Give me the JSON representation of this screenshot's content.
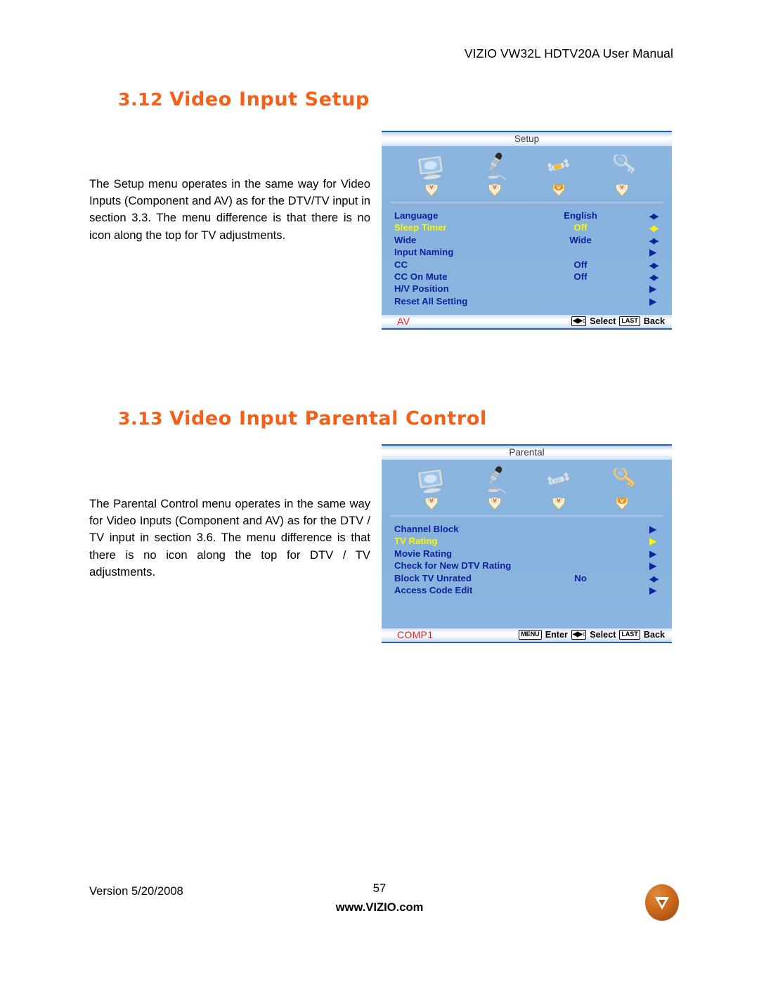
{
  "header": {
    "manual_title": "VIZIO VW32L HDTV20A User Manual"
  },
  "sections": [
    {
      "number": "3.12",
      "title": "Video Input Setup",
      "paragraph": "The Setup menu operates in the same way for Video Inputs (Component and AV) as for the DTV/TV input in section 3.3.  The menu difference is that there is no icon along the top for TV adjustments."
    },
    {
      "number": "3.13",
      "title": "Video Input Parental Control",
      "paragraph": "The Parental Control menu operates in the same way for Video Inputs (Component and AV) as for the DTV / TV input in section 3.6.  The menu difference is that there is no icon along the top for DTV / TV adjustments."
    }
  ],
  "osd_setup": {
    "title": "Setup",
    "icons": [
      {
        "name": "tv-picture-icon",
        "active": false
      },
      {
        "name": "microphone-audio-icon",
        "active": false
      },
      {
        "name": "wrench-setup-icon",
        "active": true
      },
      {
        "name": "key-parental-icon",
        "active": false
      }
    ],
    "rows": [
      {
        "label": "Language",
        "value": "English",
        "arrow": "lr",
        "selected": false
      },
      {
        "label": "Sleep Timer",
        "value": "Off",
        "arrow": "lr",
        "selected": true
      },
      {
        "label": "Wide",
        "value": "Wide",
        "arrow": "lr",
        "selected": false
      },
      {
        "label": "Input Naming",
        "value": "",
        "arrow": "r",
        "selected": false
      },
      {
        "label": "CC",
        "value": "Off",
        "arrow": "lr",
        "selected": false
      },
      {
        "label": "CC On Mute",
        "value": "Off",
        "arrow": "lr",
        "selected": false
      },
      {
        "label": "H/V Position",
        "value": "",
        "arrow": "r",
        "selected": false
      },
      {
        "label": "Reset All Setting",
        "value": "",
        "arrow": "r",
        "selected": false
      }
    ],
    "input_label": "AV",
    "hints": [
      {
        "key": "◀▶↕",
        "text": "Select"
      },
      {
        "key": "LAST",
        "text": "Back"
      }
    ]
  },
  "osd_parental": {
    "title": "Parental",
    "icons": [
      {
        "name": "tv-picture-icon",
        "active": false
      },
      {
        "name": "microphone-audio-icon",
        "active": false
      },
      {
        "name": "wrench-setup-icon",
        "active": false
      },
      {
        "name": "key-parental-icon",
        "active": true
      }
    ],
    "rows": [
      {
        "label": "Channel Block",
        "value": "",
        "arrow": "r",
        "selected": false
      },
      {
        "label": "TV Rating",
        "value": "",
        "arrow": "r",
        "selected": true
      },
      {
        "label": "Movie Rating",
        "value": "",
        "arrow": "r",
        "selected": false
      },
      {
        "label": "Check for New DTV Rating",
        "value": "",
        "arrow": "r",
        "selected": false
      },
      {
        "label": "Block TV Unrated",
        "value": "No",
        "arrow": "lr",
        "selected": false
      },
      {
        "label": "Access Code Edit",
        "value": "",
        "arrow": "r",
        "selected": false
      }
    ],
    "input_label": "COMP1",
    "hints": [
      {
        "key": "MENU",
        "text": "Enter"
      },
      {
        "key": "◀▶↕",
        "text": "Select"
      },
      {
        "key": "LAST",
        "text": "Back"
      }
    ]
  },
  "footer": {
    "version": "Version 5/20/2008",
    "page_number": "57",
    "url": "www.VIZIO.com",
    "logo_letter": "V"
  },
  "colors": {
    "accent_orange": "#F4601A",
    "osd_background": "#8db7e0",
    "osd_label_blue": "#11219b",
    "osd_selected_yellow": "#fdf500",
    "osd_input_red": "#e8201e",
    "logo_orange": "#d2701f"
  }
}
